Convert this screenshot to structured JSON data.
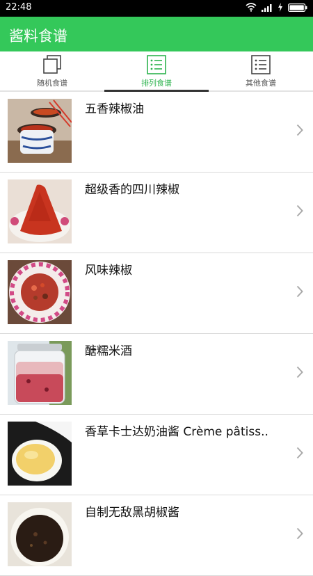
{
  "status": {
    "time": "22:48"
  },
  "app": {
    "title": "酱料食谱"
  },
  "tabs": [
    {
      "label": "随机食谱",
      "active": false,
      "icon": "copy-icon"
    },
    {
      "label": "排列食谱",
      "active": true,
      "icon": "list-icon"
    },
    {
      "label": "其他食谱",
      "active": false,
      "icon": "list-icon"
    }
  ],
  "recipes": [
    {
      "title": "五香辣椒油",
      "image": "chili-oil-bowl-photo"
    },
    {
      "title": "超级香的四川辣椒",
      "image": "chili-powder-plate-photo"
    },
    {
      "title": "风味辣椒",
      "image": "minced-chili-plate-photo"
    },
    {
      "title": "醣糯米酒",
      "image": "rice-wine-jar-photo"
    },
    {
      "title": "香草卡士达奶油酱 Crème pâtiss..",
      "image": "custard-spoon-photo"
    },
    {
      "title": "自制无敌黑胡椒酱",
      "image": "black-pepper-sauce-photo"
    }
  ],
  "colors": {
    "appbar": "#34c85a",
    "active_tab": "#2db34e"
  }
}
